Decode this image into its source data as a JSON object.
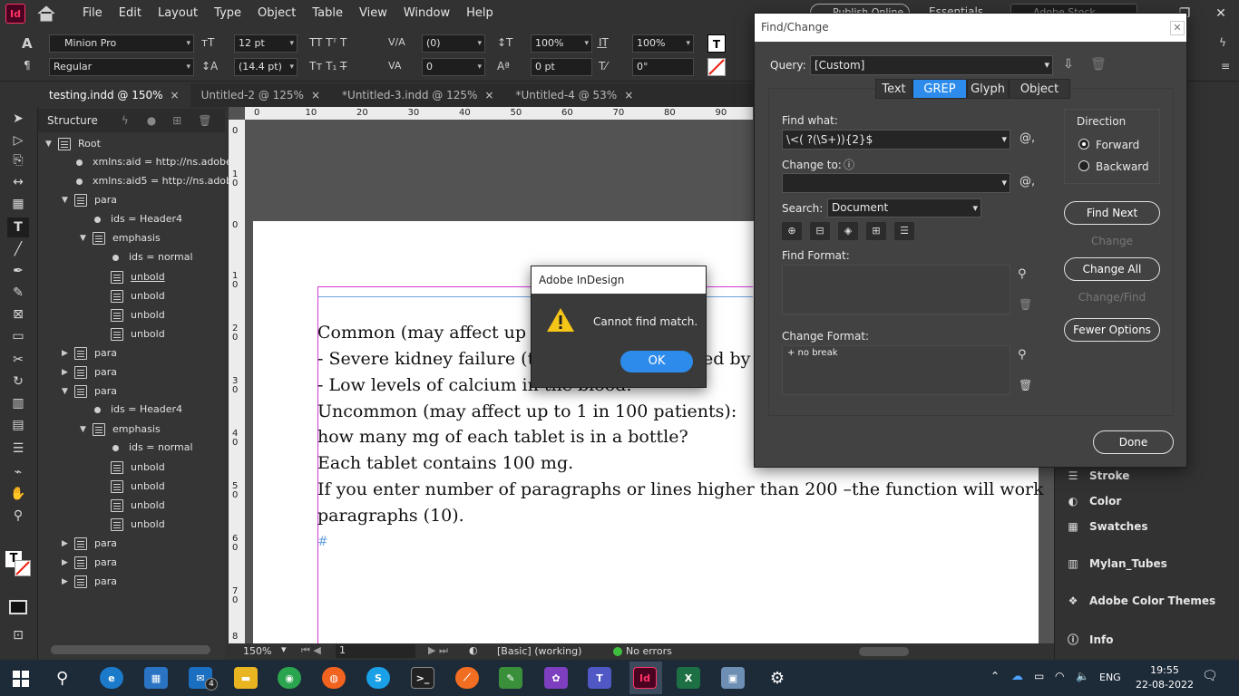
{
  "app": {
    "logo": "Id",
    "menus": [
      "File",
      "Edit",
      "Layout",
      "Type",
      "Object",
      "Table",
      "View",
      "Window",
      "Help"
    ],
    "workspace": "Essentials",
    "publish": "Publish Online",
    "stock_search": "Adobe Stock"
  },
  "control": {
    "font_family": "Minion Pro",
    "font_style": "Regular",
    "font_size": "12 pt",
    "leading": "(14.4 pt)",
    "kerning": "(0)",
    "tracking": "0",
    "h_scale": "100%",
    "v_scale": "100%",
    "baseline": "0 pt",
    "skew": "0°"
  },
  "tabs": [
    {
      "label": "testing.indd @ 150%",
      "close": "×"
    },
    {
      "label": "Untitled-2 @ 125%",
      "close": "×"
    },
    {
      "label": "*Untitled-3.indd @ 125%",
      "close": "×"
    },
    {
      "label": "*Untitled-4 @ 53%",
      "close": "×"
    }
  ],
  "structure": {
    "title": "Structure",
    "nodes": [
      {
        "text": "Root"
      },
      {
        "text": "xmlns:aid = http://ns.adobe.com/Ad"
      },
      {
        "text": "xmlns:aid5 = http://ns.adobe.com/Ad"
      },
      {
        "text": "para"
      },
      {
        "text": "ids = Header4"
      },
      {
        "text": "emphasis"
      },
      {
        "text": "ids = normal"
      },
      {
        "text": "unbold"
      },
      {
        "text": "unbold"
      },
      {
        "text": "unbold"
      },
      {
        "text": "unbold"
      },
      {
        "text": "para"
      },
      {
        "text": "para"
      },
      {
        "text": "para"
      },
      {
        "text": "ids = Header4"
      },
      {
        "text": "emphasis"
      },
      {
        "text": "ids = normal"
      },
      {
        "text": "unbold"
      },
      {
        "text": "unbold"
      },
      {
        "text": "unbold"
      },
      {
        "text": "unbold"
      },
      {
        "text": "para"
      },
      {
        "text": "para"
      },
      {
        "text": "para"
      }
    ]
  },
  "ruler": {
    "h": [
      "0",
      "10",
      "20",
      "30",
      "40",
      "50",
      "60",
      "70",
      "80",
      "90"
    ],
    "v": [
      "0",
      "1\n0",
      "0",
      "1\n0",
      "2\n0",
      "3\n0",
      "4\n0",
      "5\n0",
      "6\n0",
      "7\n0",
      "8"
    ]
  },
  "document": {
    "lines": [
      "Common (may affect up",
      "- Severe kidney failure (t",
      "- Low levels of calcium in the blood.",
      "Uncommon (may affect up to 1 in 100 patients):",
      "how many mg of each tablet is in a bottle?",
      "Each tablet contains 100 mg.",
      "If you enter number of paragraphs or lines higher than 200 –the function will work",
      "paragraphs (10)."
    ],
    "fragment_right": "ed by"
  },
  "status": {
    "zoom": "150%",
    "page": "1",
    "style": "[Basic] (working)",
    "preflight": "No errors"
  },
  "alert": {
    "title": "Adobe InDesign",
    "message": "Cannot find match.",
    "ok": "OK"
  },
  "find_change": {
    "title": "Find/Change",
    "query_label": "Query:",
    "query_value": "[Custom]",
    "tabs": [
      "Text",
      "GREP",
      "Glyph",
      "Object"
    ],
    "find_what_label": "Find what:",
    "find_what_value": "\\<( ?(\\S+)){2}$",
    "change_to_label": "Change to:",
    "change_to_value": "",
    "search_label": "Search:",
    "search_value": "Document",
    "find_format_label": "Find Format:",
    "change_format_label": "Change Format:",
    "change_format_value": "+ no break",
    "direction_label": "Direction",
    "forward": "Forward",
    "backward": "Backward",
    "buttons": {
      "find_next": "Find Next",
      "change": "Change",
      "change_all": "Change All",
      "change_find": "Change/Find",
      "fewer": "Fewer Options",
      "done": "Done"
    }
  },
  "right_panel": {
    "items": [
      "Stroke",
      "Color",
      "Swatches",
      "Mylan_Tubes",
      "Adobe Color Themes",
      "Info"
    ]
  },
  "taskbar": {
    "time": "19:55",
    "date": "22-08-2022",
    "lang": "ENG",
    "mail_badge": "4"
  }
}
